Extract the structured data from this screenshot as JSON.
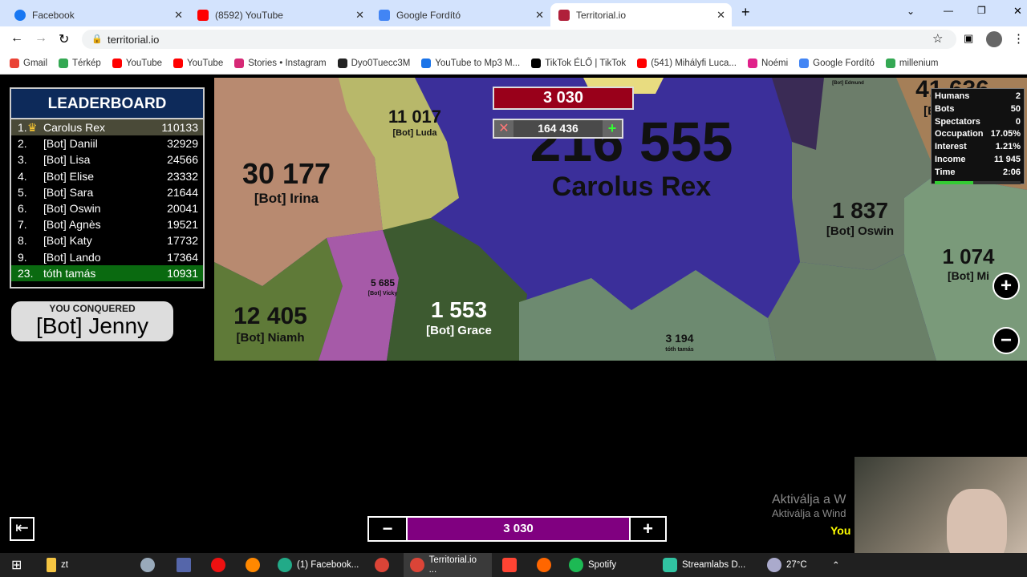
{
  "browser": {
    "tabs": [
      {
        "label": "Facebook",
        "color": "#1877f2"
      },
      {
        "label": "(8592) YouTube",
        "color": "#ff0000"
      },
      {
        "label": "Google Fordító",
        "color": "#4285f4"
      },
      {
        "label": "Territorial.io",
        "color": "#b0203a",
        "active": true
      }
    ],
    "new_tab": "+",
    "url": "territorial.io",
    "bookmarks": [
      {
        "label": "Gmail",
        "color": "#ea4335"
      },
      {
        "label": "Térkép",
        "color": "#34a853"
      },
      {
        "label": "YouTube",
        "color": "#ff0000"
      },
      {
        "label": "YouTube",
        "color": "#ff0000"
      },
      {
        "label": "Stories • Instagram",
        "color": "#d62976"
      },
      {
        "label": "Dyo0Tuecc3M",
        "color": "#222"
      },
      {
        "label": "YouTube to Mp3 M...",
        "color": "#1a73e8"
      },
      {
        "label": "TikTok ÉLŐ | TikTok",
        "color": "#000"
      },
      {
        "label": "(541) Mihályfi Luca...",
        "color": "#ff0000"
      },
      {
        "label": "Noémi",
        "color": "#e0218a"
      },
      {
        "label": "Google Fordító",
        "color": "#4285f4"
      },
      {
        "label": "millenium",
        "color": "#34a853"
      }
    ]
  },
  "leaderboard": {
    "title": "LEADERBOARD",
    "rows": [
      {
        "rank": "1.",
        "name": "Carolus Rex",
        "score": "110133",
        "crown": true
      },
      {
        "rank": "2.",
        "name": "[Bot] Daniil",
        "score": "32929"
      },
      {
        "rank": "3.",
        "name": "[Bot] Lisa",
        "score": "24566"
      },
      {
        "rank": "4.",
        "name": "[Bot] Elise",
        "score": "23332"
      },
      {
        "rank": "5.",
        "name": "[Bot] Sara",
        "score": "21644"
      },
      {
        "rank": "6.",
        "name": "[Bot] Oswin",
        "score": "20041"
      },
      {
        "rank": "7.",
        "name": "[Bot] Agnès",
        "score": "19521"
      },
      {
        "rank": "8.",
        "name": "[Bot] Katy",
        "score": "17732"
      },
      {
        "rank": "9.",
        "name": "[Bot] Lando",
        "score": "17364"
      },
      {
        "rank": "23.",
        "name": "tóth tamás",
        "score": "10931",
        "self": true
      }
    ]
  },
  "conquered": {
    "label": "YOU CONQUERED",
    "name": "[Bot] Jenny"
  },
  "stats": {
    "rows": [
      {
        "k": "Humans",
        "v": "2"
      },
      {
        "k": "Bots",
        "v": "50"
      },
      {
        "k": "Spectators",
        "v": "0"
      },
      {
        "k": "Occupation",
        "v": "17.05%"
      },
      {
        "k": "Interest",
        "v": "1.21%"
      },
      {
        "k": "Income",
        "v": "11 945"
      },
      {
        "k": "Time",
        "v": "2:06"
      }
    ],
    "progress": 0.45
  },
  "attack": {
    "troops": "3 030",
    "target_value": "164 436"
  },
  "map_labels": [
    {
      "n": "216 555",
      "s": "Carolus Rex"
    },
    {
      "n": "11 017",
      "s": "[Bot] Luda"
    },
    {
      "n": "30 177",
      "s": "[Bot] Irina"
    },
    {
      "n": "1 837",
      "s": "[Bot] Oswin"
    },
    {
      "n": "1 074",
      "s": "[Bot] Mi"
    },
    {
      "n": "12 405",
      "s": "[Bot] Niamh"
    },
    {
      "n": "1 553",
      "s": "[Bot] Grace"
    },
    {
      "n": "5 685",
      "s": "[Bot] Vicky"
    },
    {
      "n": "3 194",
      "s": "tóth tamás"
    },
    {
      "n": "41 636",
      "s": "[Bot] Sara"
    },
    {
      "n": "",
      "s": "[Bot] Edmund"
    }
  ],
  "bottom_bar": {
    "minus": "−",
    "value": "3 030",
    "plus": "+",
    "ratio": 0.75
  },
  "zoom": {
    "in": "+",
    "out": "−"
  },
  "watermark": {
    "line1": "Aktiválja a W",
    "line2": "Aktiválja a Wind",
    "line3": "You"
  },
  "taskbar": {
    "items": [
      "zt",
      "(1) Facebook...",
      "Territorial.io ...",
      "Spotify",
      "Streamlabs D..."
    ],
    "weather": "27°C"
  }
}
